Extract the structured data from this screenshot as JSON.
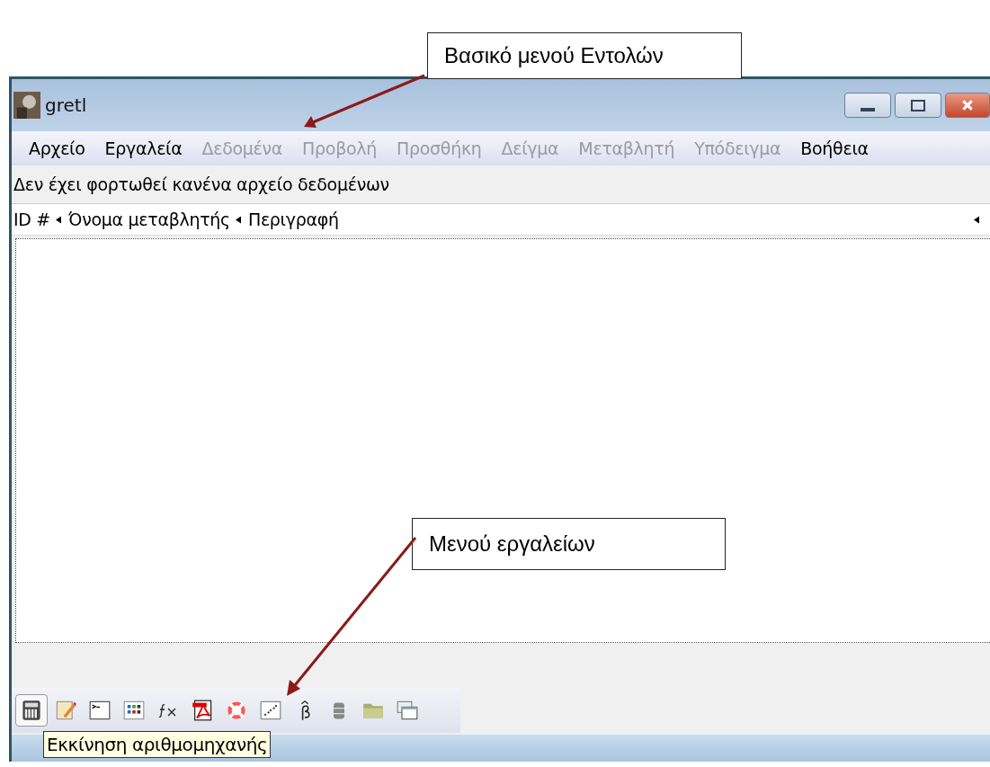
{
  "annotations": [
    {
      "text": "Βασικό μενού Εντολών",
      "kind": "top"
    },
    {
      "text": "Μενού εργαλείων",
      "kind": "bottom"
    }
  ],
  "window": {
    "title": "gretl"
  },
  "menu": [
    {
      "label": "Αρχείο",
      "disabled": false
    },
    {
      "label": "Εργαλεία",
      "disabled": false
    },
    {
      "label": "Δεδομένα",
      "disabled": true
    },
    {
      "label": "Προβολή",
      "disabled": true
    },
    {
      "label": "Προσθήκη",
      "disabled": true
    },
    {
      "label": "Δείγμα",
      "disabled": true
    },
    {
      "label": "Μεταβλητή",
      "disabled": true
    },
    {
      "label": "Υπόδειγμα",
      "disabled": true
    },
    {
      "label": "Βοήθεια",
      "disabled": false
    }
  ],
  "status": "Δεν έχει φορτωθεί κανένα αρχείο δεδομένων",
  "columns": [
    "ID #",
    "Όνομα μεταβλητής",
    "Περιγραφή"
  ],
  "toolbar": [
    {
      "kind": "calculator",
      "selected": true
    },
    {
      "kind": "editor",
      "selected": false
    },
    {
      "kind": "console",
      "selected": false
    },
    {
      "kind": "matrix",
      "selected": false
    },
    {
      "kind": "function",
      "selected": false
    },
    {
      "kind": "pdf",
      "selected": false
    },
    {
      "kind": "help",
      "selected": false
    },
    {
      "kind": "plot",
      "selected": false
    },
    {
      "kind": "beta",
      "selected": false
    },
    {
      "kind": "database",
      "selected": false
    },
    {
      "kind": "folder",
      "selected": false
    },
    {
      "kind": "windows",
      "selected": false
    }
  ],
  "tooltip": "Εκκίνηση αριθμομηχανής"
}
